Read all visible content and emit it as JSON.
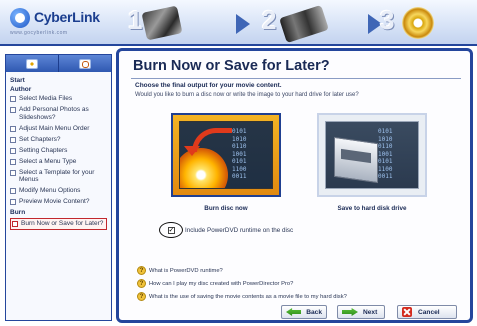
{
  "header": {
    "logo_text": "CyberLink",
    "logo_url": "www.gocyberlink.com",
    "steps": [
      "1",
      "2",
      "3"
    ]
  },
  "sidebar": {
    "sections": [
      {
        "label": "Start"
      },
      {
        "label": "Author"
      },
      {
        "label": "Burn"
      }
    ],
    "author_items": [
      "Select Media Files",
      "Add Personal Photos as Slideshows?",
      "Adjust Main Menu Order",
      "Set Chapters?",
      "Setting Chapters",
      "Select a Menu Type",
      "Select a Template for your Menus",
      "Modify Menu Options",
      "Preview Movie Content?"
    ],
    "burn_items": [
      "Burn Now or Save for Later?"
    ]
  },
  "main": {
    "title": "Burn Now or Save for Later?",
    "subtitle": "Choose the final output for your movie content.",
    "instruction": "Would you like to burn a disc now or write the image to your hard drive for later use?",
    "options": {
      "burn_label": "Burn disc now",
      "save_label": "Save to hard disk drive"
    },
    "include_label": "Include PowerDVD runtime on the disc",
    "include_checked": true,
    "faq": [
      "What is PowerDVD runtime?",
      "How can I play my disc created with PowerDirector Pro?",
      "What is the use of saving the movie contents as a movie file to my hard disk?"
    ],
    "buttons": {
      "back": "Back",
      "next": "Next",
      "cancel": "Cancel"
    }
  },
  "colors": {
    "accent": "#24469c",
    "highlight": "#c1272d",
    "burn_tile": "#f3b324"
  }
}
